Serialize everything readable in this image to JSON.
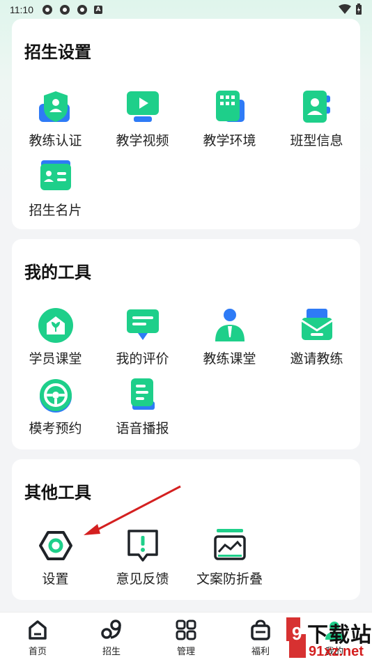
{
  "status_bar": {
    "time": "11:10",
    "indicator_letter": "A"
  },
  "sections": [
    {
      "title": "招生设置",
      "items": [
        {
          "label": "教练认证",
          "icon": "shield-user-icon"
        },
        {
          "label": "教学视频",
          "icon": "video-play-icon"
        },
        {
          "label": "教学环境",
          "icon": "building-icon"
        },
        {
          "label": "班型信息",
          "icon": "contact-card-icon"
        },
        {
          "label": "招生名片",
          "icon": "business-card-icon"
        }
      ]
    },
    {
      "title": "我的工具",
      "items": [
        {
          "label": "学员课堂",
          "icon": "classroom-icon"
        },
        {
          "label": "我的评价",
          "icon": "comment-icon"
        },
        {
          "label": "教练课堂",
          "icon": "coach-icon"
        },
        {
          "label": "邀请教练",
          "icon": "invite-mail-icon"
        },
        {
          "label": "模考预约",
          "icon": "steering-wheel-icon"
        },
        {
          "label": "语音播报",
          "icon": "voice-broadcast-icon"
        }
      ]
    },
    {
      "title": "其他工具",
      "items": [
        {
          "label": "设置",
          "icon": "settings-hex-icon"
        },
        {
          "label": "意见反馈",
          "icon": "feedback-icon"
        },
        {
          "label": "文案防折叠",
          "icon": "copy-unfold-icon"
        }
      ]
    }
  ],
  "bottom_nav": [
    {
      "label": "首页",
      "icon": "home-icon"
    },
    {
      "label": "招生",
      "icon": "recruit-icon"
    },
    {
      "label": "管理",
      "icon": "grid-icon"
    },
    {
      "label": "福利",
      "icon": "bag-icon"
    },
    {
      "label": "我的",
      "icon": "profile-icon"
    }
  ],
  "watermark": {
    "text": "下载站",
    "url_text": "91xz.net"
  },
  "colors": {
    "accent": "#1ecf8a",
    "accent_dark": "#16b877",
    "blue": "#2e7bf6",
    "arrow": "#d42020"
  }
}
